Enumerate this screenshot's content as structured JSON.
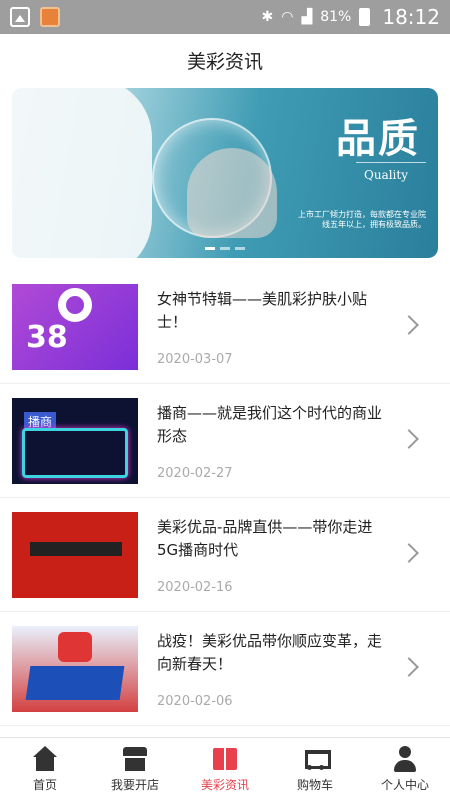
{
  "status_bar": {
    "battery": "81%",
    "time": "18:12"
  },
  "header": {
    "title": "美彩资讯"
  },
  "banner": {
    "title": "品质",
    "subtitle": "Quality",
    "caption": "上市工厂倾力打造，每款都在专业院线五年以上，拥有极致品质。"
  },
  "news": [
    {
      "title": "女神节特辑——美肌彩护肤小贴士！",
      "date": "2020-03-07"
    },
    {
      "title": "播商——就是我们这个时代的商业形态",
      "date": "2020-02-27"
    },
    {
      "title": "美彩优品-品牌直供——带你走进5G播商时代",
      "date": "2020-02-16"
    },
    {
      "title": "战疫！美彩优品带你顺应变革，走向新春天！",
      "date": "2020-02-06"
    }
  ],
  "tabs": [
    {
      "label": "首页"
    },
    {
      "label": "我要开店"
    },
    {
      "label": "美彩资讯"
    },
    {
      "label": "购物车"
    },
    {
      "label": "个人中心"
    }
  ],
  "colors": {
    "accent": "#e8414d",
    "status_bar": "#9e9e9e"
  }
}
